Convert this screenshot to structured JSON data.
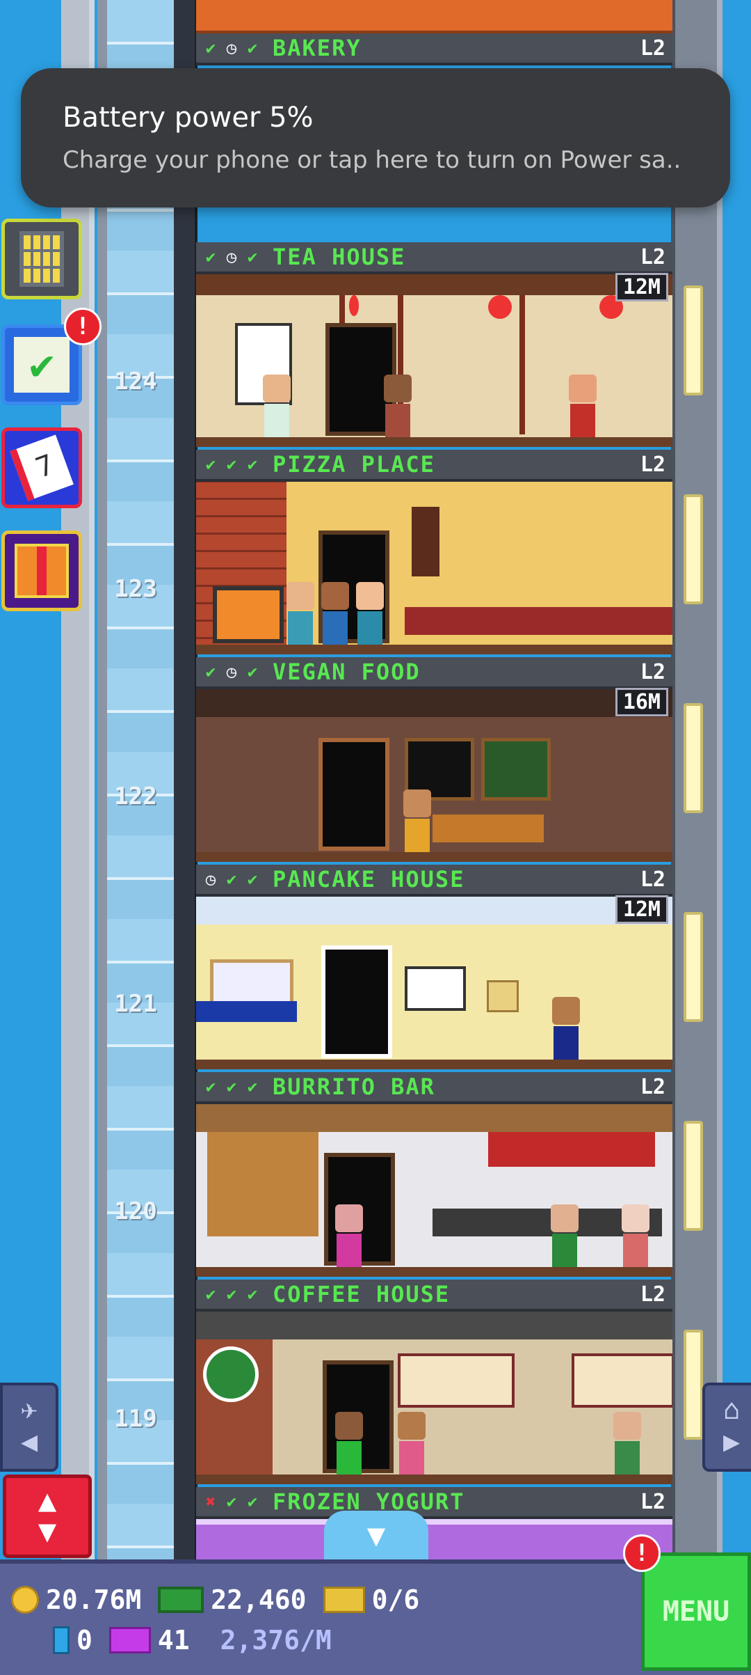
{
  "notification": {
    "title": "Battery power 5%",
    "body": "Charge your phone or tap here to turn on Power sa.."
  },
  "floors": [
    {
      "name": "BAKERY",
      "level": "L2",
      "status": [
        "check",
        "clock",
        "check"
      ],
      "timer": ""
    },
    {
      "name": "TEA HOUSE",
      "level": "L2",
      "status": [
        "check",
        "clock",
        "check"
      ],
      "timer": "12M",
      "number": "124"
    },
    {
      "name": "PIZZA PLACE",
      "level": "L2",
      "status": [
        "check",
        "check",
        "check"
      ],
      "timer": "",
      "number": "123"
    },
    {
      "name": "VEGAN FOOD",
      "level": "L2",
      "status": [
        "check",
        "clock",
        "check"
      ],
      "timer": "16M",
      "number": "122"
    },
    {
      "name": "PANCAKE HOUSE",
      "level": "L2",
      "status": [
        "clock",
        "check",
        "check"
      ],
      "timer": "12M",
      "number": "121"
    },
    {
      "name": "BURRITO BAR",
      "level": "L2",
      "status": [
        "check",
        "check",
        "check"
      ],
      "timer": "",
      "number": "120"
    },
    {
      "name": "COFFEE HOUSE",
      "level": "L2",
      "status": [
        "check",
        "check",
        "check"
      ],
      "timer": "",
      "number": "119"
    },
    {
      "name": "FROZEN YOGURT",
      "level": "L2",
      "status": [
        "x",
        "check",
        "check"
      ],
      "timer": ""
    }
  ],
  "side_badges": {
    "missions": "!",
    "bottom": "!"
  },
  "hud": {
    "coins": "20.76M",
    "bux": "22,460",
    "tickets": "0/6",
    "bits": "0",
    "vip": "41",
    "rate": "2,376/M",
    "menu": "MENU"
  },
  "colors": {
    "floor_label": "#58e851",
    "sky": "#2a9ee0",
    "menu": "#38d84a"
  }
}
